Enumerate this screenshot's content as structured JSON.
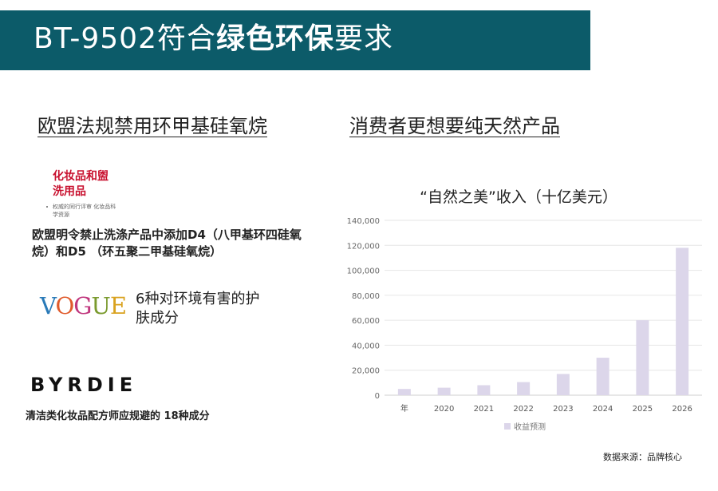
{
  "banner": {
    "title_prefix": "BT-9502符合",
    "title_bold": "绿色环保",
    "title_suffix": "要求",
    "color": "#0c5b69"
  },
  "left": {
    "heading": "欧盟法规禁用环甲基硅氧烷",
    "journal": {
      "name": "化妆品和盥洗用品",
      "subtitle": "权威的同行评审 化妆品科学资源",
      "color": "#c8102e"
    },
    "eu_text": "欧盟明令禁止洗涤产品中添加D4（八甲基环四硅氧烷）和D5 （环五聚二甲基硅氧烷）",
    "vogue": {
      "logo": "VOGUE",
      "text": "6种对环境有害的护肤成分"
    },
    "byrdie": {
      "logo": "BYRDIE",
      "text": "清洁类化妆品配方师应规避的 18种成分"
    }
  },
  "right": {
    "heading": "消费者更想要纯天然产品"
  },
  "chart_data": {
    "type": "bar",
    "title": "“自然之美”收入（十亿美元）",
    "categories": [
      "年",
      "2020",
      "2021",
      "2022",
      "2023",
      "2024",
      "2025",
      "2026"
    ],
    "series": [
      {
        "name": "收益预测",
        "values": [
          5000,
          6000,
          8000,
          10500,
          17000,
          30000,
          60000,
          118000
        ],
        "color": "#dcd6ea"
      }
    ],
    "ylim": [
      0,
      140000
    ],
    "yticks": [
      "0",
      "20,000",
      "40,000",
      "60,000",
      "80,000",
      "100,000",
      "120,000",
      "140,000"
    ],
    "grid": true,
    "legend_position": "bottom-center"
  },
  "source": "数据来源：品牌核心"
}
